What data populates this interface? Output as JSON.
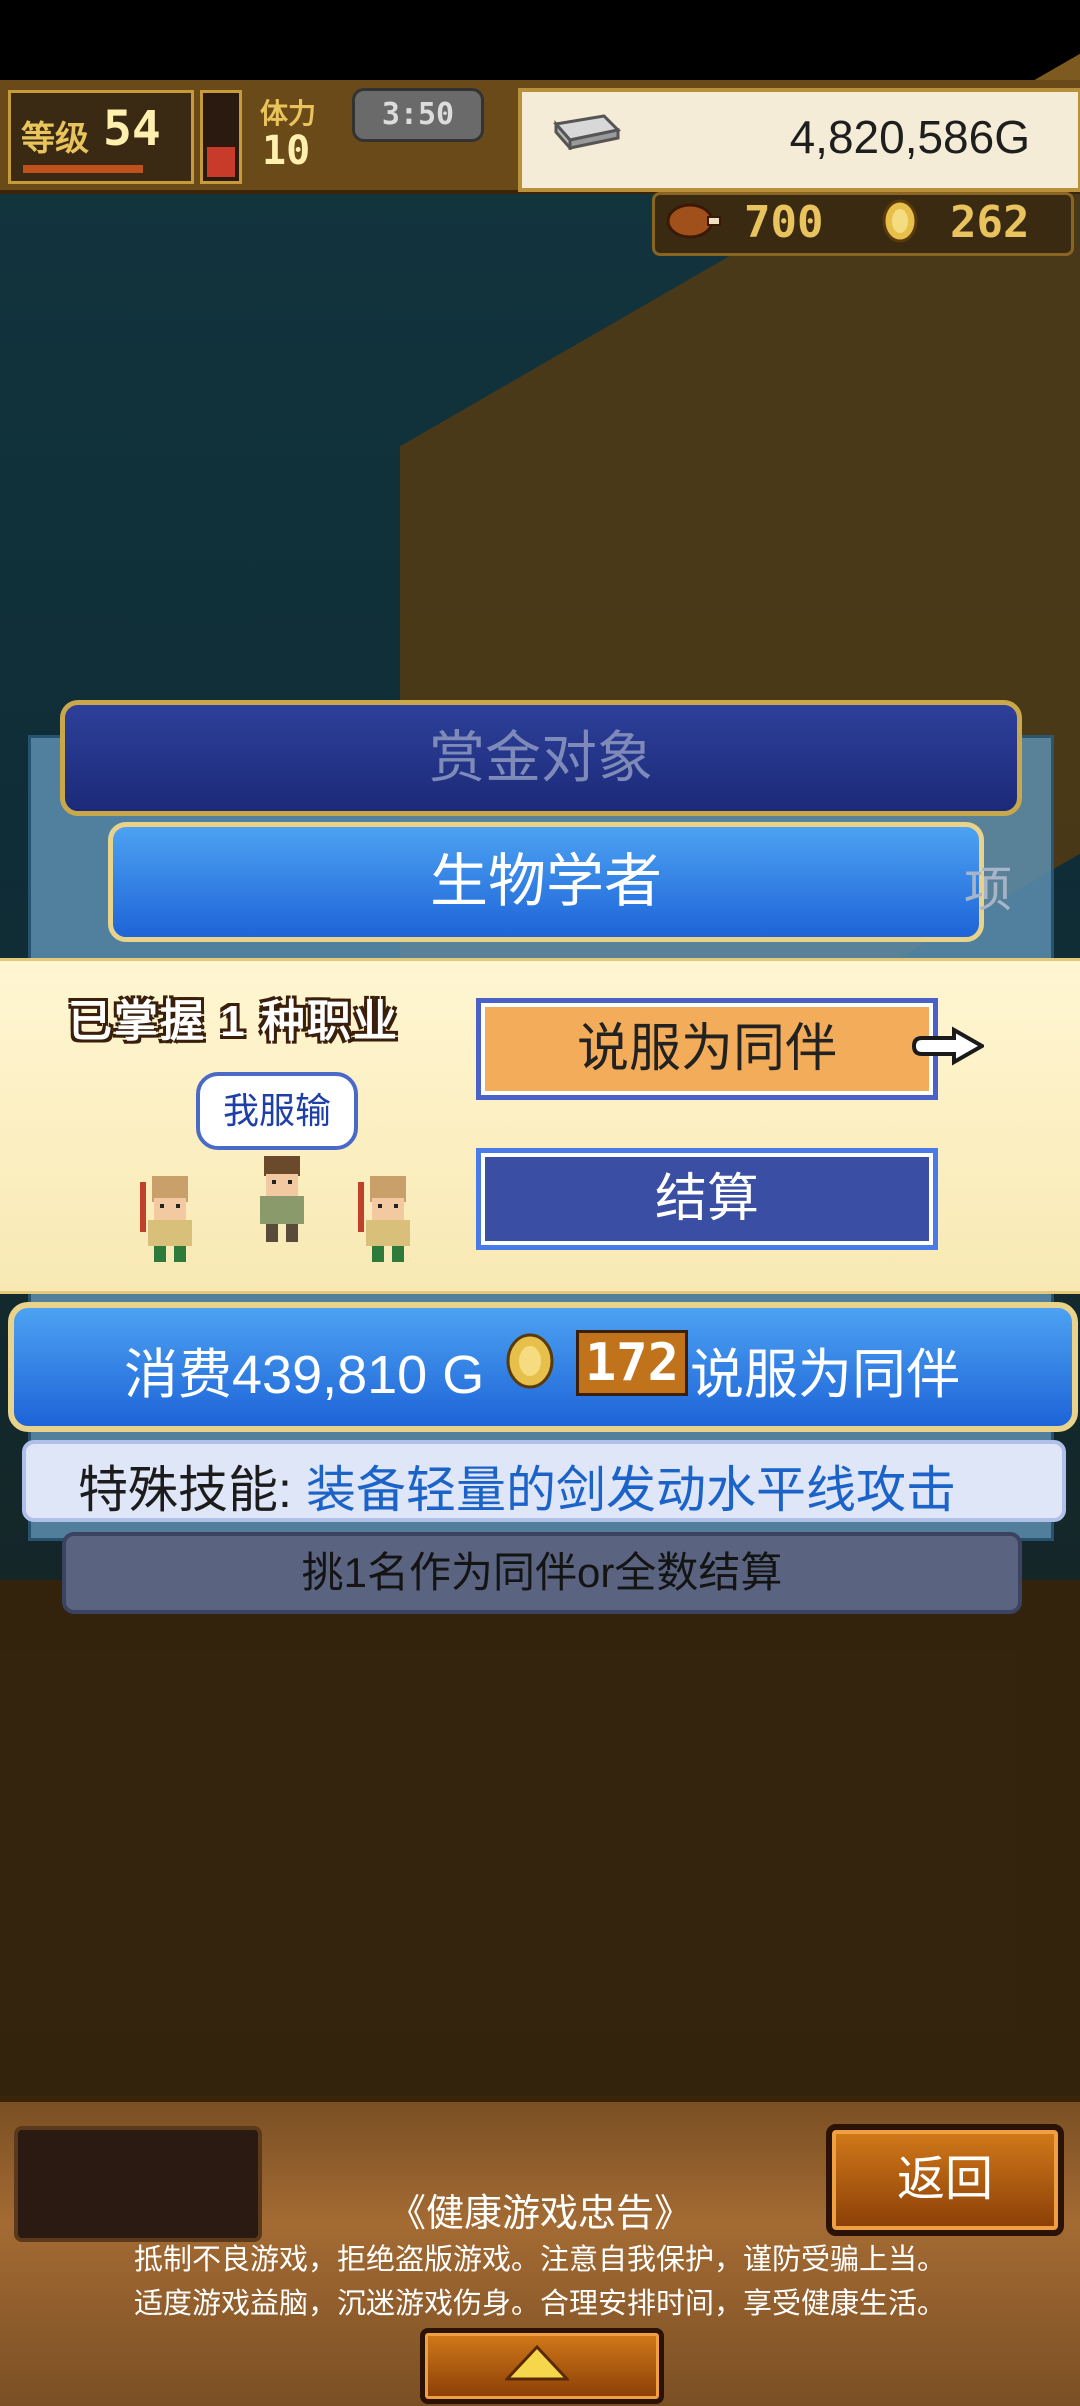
{
  "hud": {
    "level_label": "等级",
    "level_value": "54",
    "stamina_label": "体力",
    "stamina_value": "10",
    "timer": "3:50",
    "gold": "4,820,586G"
  },
  "counters": {
    "meat": "700",
    "medals": "262"
  },
  "bounty": {
    "header": "赏金对象",
    "target": "生物学者",
    "edge_char": "项"
  },
  "choice": {
    "mastered": "已掌握 1 种职业",
    "speech": "我服输",
    "recruit_label": "说服为同伴",
    "settle_label": "结算"
  },
  "cost": {
    "prefix": "消费439,810 G",
    "coins": "172",
    "action": "说服为同伴"
  },
  "skill": {
    "label": "特殊技能:",
    "text": "装备轻量的剑发动水平线攻击"
  },
  "hint": "挑1名作为同伴or全数结算",
  "bottom": {
    "back_label": "返回",
    "advice_title": "《健康游戏忠告》",
    "advice_line1": "抵制不良游戏，拒绝盗版游戏。注意自我保护，谨防受骗上当。",
    "advice_line2": "适度游戏益脑，沉迷游戏伤身。合理安排时间，享受健康生活。"
  },
  "icons": {
    "silver": "silver-bar-icon",
    "meat": "meat-icon",
    "medal": "medal-icon",
    "coin": "gold-coin-icon",
    "pointer": "pointing-hand-icon",
    "expand": "triangle-up-icon"
  },
  "colors": {
    "panel_blue": "#1d64d8",
    "choice_bg": "#fff6d2",
    "recruit_orange": "#f3ad5a",
    "settle_navy": "#3a4ea4",
    "skill_blue": "#1b63c9"
  }
}
